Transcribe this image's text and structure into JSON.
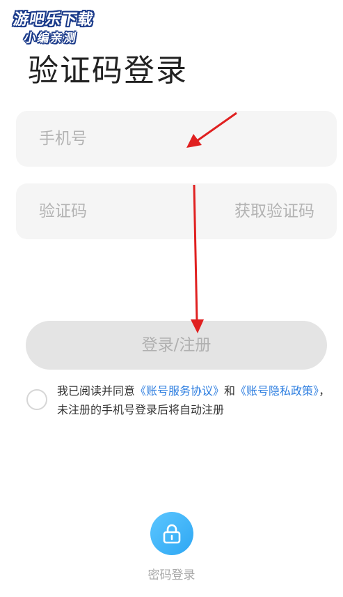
{
  "watermark": {
    "line1": "游吧乐下载",
    "line2": "小编亲测"
  },
  "page_title": "验证码登录",
  "phone_field": {
    "placeholder": "手机号"
  },
  "code_field": {
    "placeholder": "验证码",
    "get_code_label": "获取验证码"
  },
  "login_button": "登录/注册",
  "agreement": {
    "prefix": "我已阅读并同意",
    "service_link": "《账号服务协议》",
    "and": "和",
    "privacy_link": "《账号隐私政策》",
    "suffix": "，未注册的手机号登录后将自动注册"
  },
  "alt_login": {
    "icon": "lock-icon",
    "label": "密码登录"
  },
  "colors": {
    "accent": "#2f7fe0",
    "icon_bg": "#3fb4f8",
    "annotation_arrow": "#e02020"
  }
}
